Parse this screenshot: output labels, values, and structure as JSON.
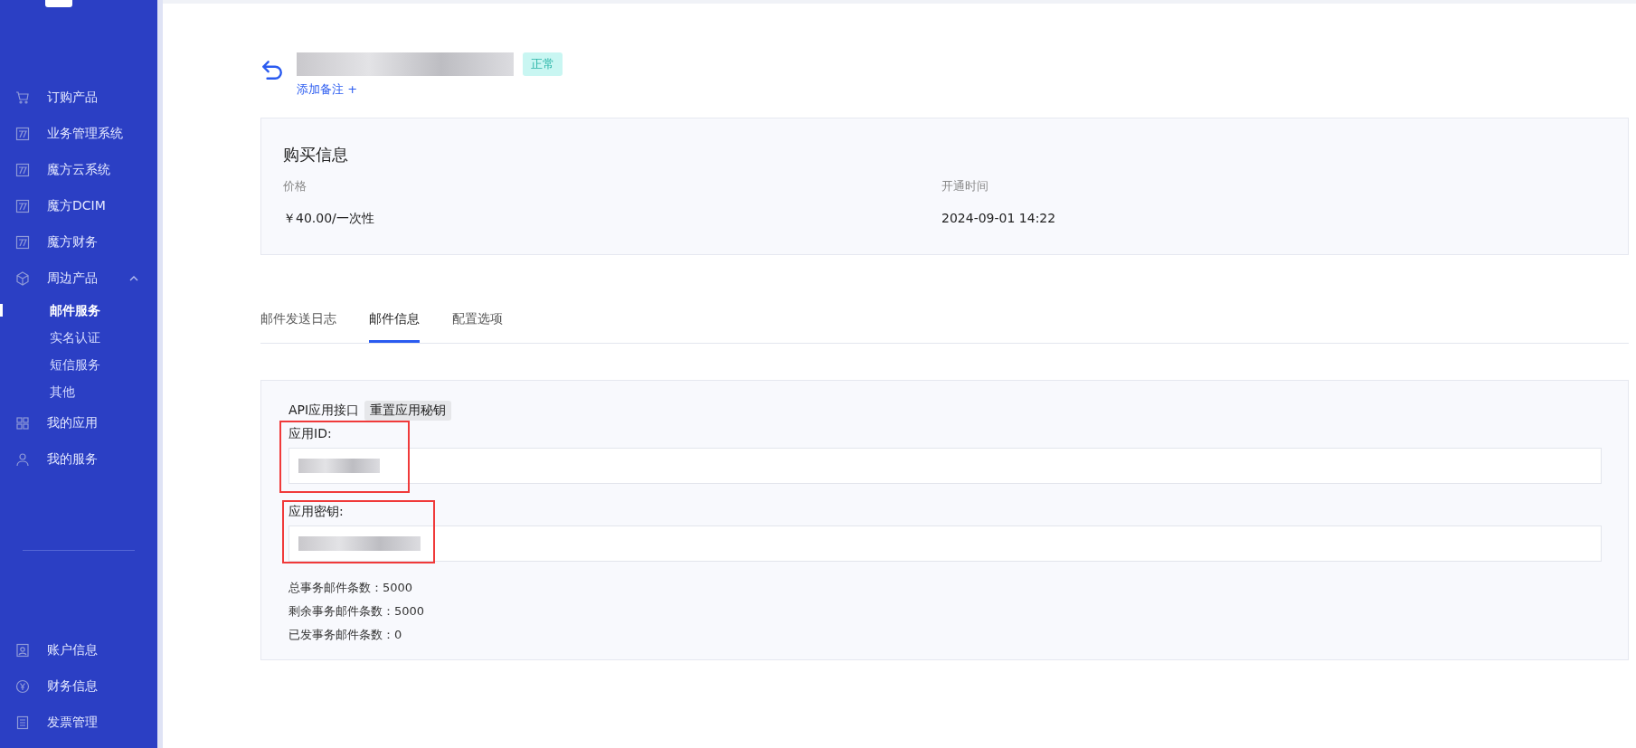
{
  "sidebar": {
    "items": [
      {
        "label": "订购产品"
      },
      {
        "label": "业务管理系统"
      },
      {
        "label": "魔方云系统"
      },
      {
        "label": "魔方DCIM"
      },
      {
        "label": "魔方财务"
      },
      {
        "label": "周边产品",
        "expanded": true,
        "children": [
          {
            "label": "邮件服务",
            "selected": true
          },
          {
            "label": "实名认证",
            "selected": false
          },
          {
            "label": "短信服务",
            "selected": false
          },
          {
            "label": "其他",
            "selected": false
          }
        ]
      },
      {
        "label": "我的应用"
      },
      {
        "label": "我的服务"
      }
    ],
    "bottom_items": [
      {
        "label": "账户信息"
      },
      {
        "label": "财务信息"
      },
      {
        "label": "发票管理"
      }
    ]
  },
  "header": {
    "status": "正常",
    "add_note": "添加备注 +"
  },
  "purchase": {
    "title": "购买信息",
    "fields": [
      {
        "label": "价格",
        "value": "￥40.00/一次性"
      },
      {
        "label": "开通时间",
        "value": "2024-09-01 14:22"
      }
    ]
  },
  "tabs": [
    {
      "label": "邮件发送日志",
      "selected": false
    },
    {
      "label": "邮件信息",
      "selected": true
    },
    {
      "label": "配置选项",
      "selected": false
    }
  ],
  "mail_info": {
    "section_label": "API应用接口",
    "reset_button": "重置应用秘钥",
    "fields": [
      {
        "label": "应用ID:"
      },
      {
        "label": "应用密钥:"
      }
    ],
    "stats": [
      "总事务邮件条数：5000",
      "剩余事务邮件条数：5000",
      "已发事务邮件条数：0"
    ]
  }
}
